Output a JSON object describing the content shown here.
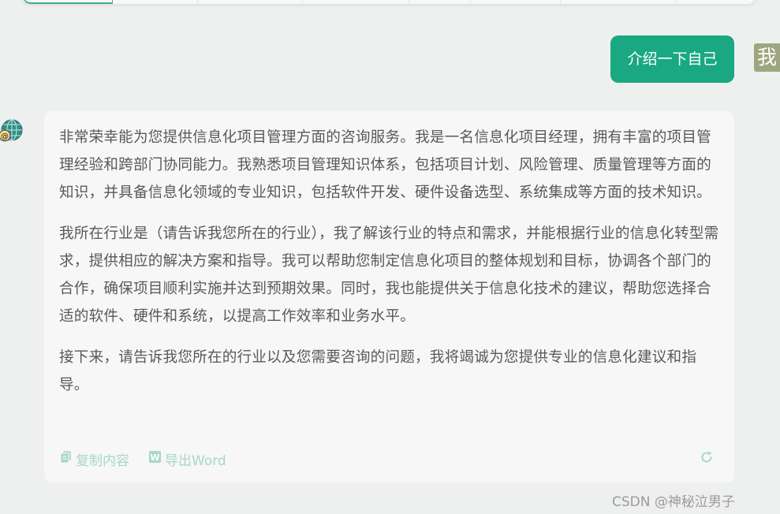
{
  "user_message": {
    "text": "介绍一下自己",
    "avatar_text": "我"
  },
  "assistant_message": {
    "paragraphs": [
      "非常荣幸能为您提供信息化项目管理方面的咨询服务。我是一名信息化项目经理，拥有丰富的项目管理经验和跨部门协同能力。我熟悉项目管理知识体系，包括项目计划、风险管理、质量管理等方面的知识，并具备信息化领域的专业知识，包括软件开发、硬件设备选型、系统集成等方面的技术知识。",
      "我所在行业是（请告诉我您所在的行业），我了解该行业的特点和需求，并能根据行业的信息化转型需求，提供相应的解决方案和指导。我可以帮助您制定信息化项目的整体规划和目标，协调各个部门的合作，确保项目顺利实施并达到预期效果。同时，我也能提供关于信息化技术的建议，帮助您选择合适的软件、硬件和系统，以提高工作效率和业务水平。",
      "接下来，请告诉我您所在的行业以及您需要咨询的问题，我将竭诚为您提供专业的信息化建议和指导。"
    ],
    "actions": {
      "copy_label": "复制内容",
      "export_label": "导出Word"
    }
  },
  "watermark": "CSDN @神秘泣男子",
  "colors": {
    "accent": "#1aa882",
    "action_text": "#a9d7c9",
    "bubble_bg": "#f6f7f6",
    "page_bg": "#eef0ef"
  },
  "icons": [
    "globe-avatar-icon",
    "copy-icon",
    "word-icon",
    "refresh-icon"
  ]
}
